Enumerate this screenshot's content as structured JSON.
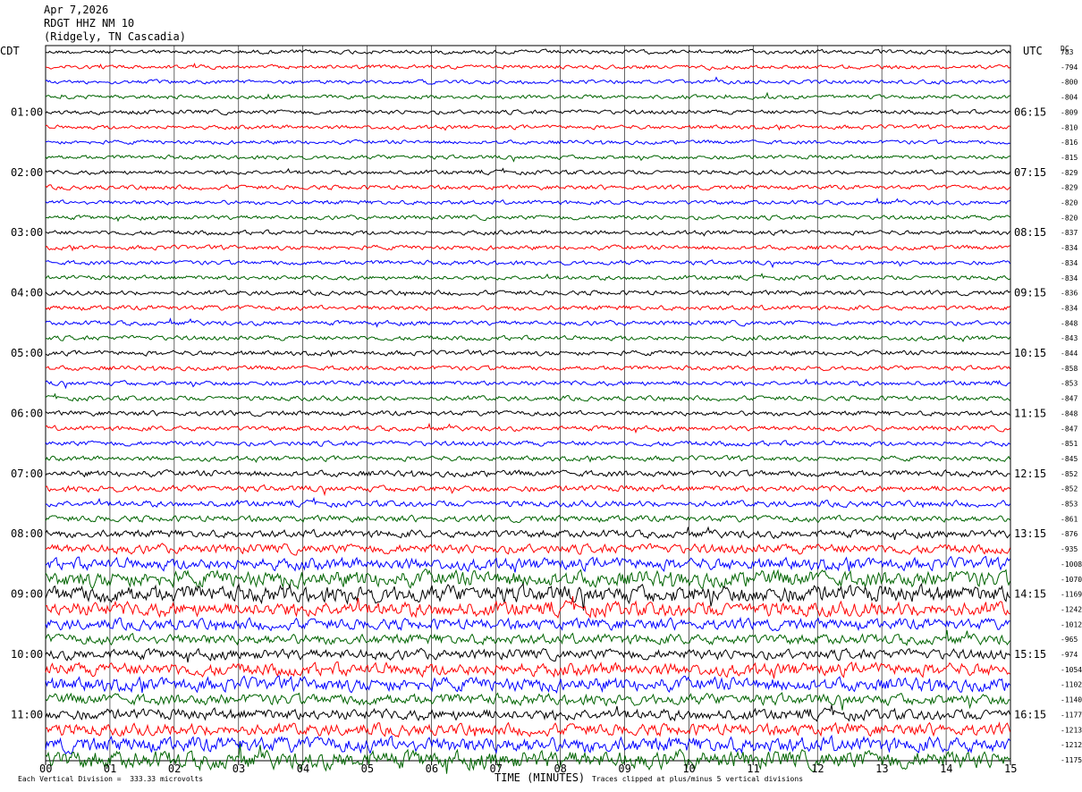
{
  "header": {
    "date": "Apr 7,2026",
    "station": "RDGT HHZ NM 10",
    "location": "(Ridgely, TN Cascadia)"
  },
  "left_tz": "CDT",
  "right_tz": "UTC",
  "dc_label": "DC",
  "footer": {
    "scale_note": "Each Vertical Division =  333.33 microvolts",
    "xlabel": "TIME (MINUTES)",
    "clip_note": "Traces clipped at plus/minus 5 vertical divisions"
  },
  "colors": {
    "trace_cycle": [
      "#000000",
      "#ff0000",
      "#0000ff",
      "#006400"
    ],
    "grid": "#000000"
  },
  "chart_data": {
    "type": "line",
    "title": "RDGT HHZ NM 10",
    "xlabel": "TIME (MINUTES)",
    "ylabel": "",
    "xlim": [
      0,
      15
    ],
    "x_ticks": [
      "00",
      "01",
      "02",
      "03",
      "04",
      "05",
      "06",
      "07",
      "08",
      "09",
      "10",
      "11",
      "12",
      "13",
      "14",
      "15"
    ],
    "left_hour_labels": [
      "01:00",
      "02:00",
      "03:00",
      "04:00",
      "05:00",
      "06:00",
      "07:00",
      "08:00",
      "09:00",
      "10:00",
      "11:00"
    ],
    "right_hour_labels": [
      "06:15",
      "07:15",
      "08:15",
      "09:15",
      "10:15",
      "11:15",
      "12:15",
      "13:15",
      "14:15",
      "15:15",
      "16:15"
    ],
    "dc_offsets": [
      "783",
      "-794",
      "-800",
      "-804",
      "-809",
      "-810",
      "-816",
      "-815",
      "-829",
      "-829",
      "-820",
      "-820",
      "-837",
      "-834",
      "-834",
      "-834",
      "-836",
      "-834",
      "-848",
      "-843",
      "-844",
      "-858",
      "-853",
      "-847",
      "-848",
      "-847",
      "-851",
      "-845",
      "-852",
      "-852",
      "-853",
      "-861",
      "-876",
      "-935",
      "-1008",
      "-1070",
      "-1169",
      "-1242",
      "-1012",
      "-965",
      "-974",
      "-1054",
      "-1102",
      "-1140",
      "-1177",
      "-1213",
      "-1212",
      "-1175"
    ],
    "trace_noise_level": [
      2.4,
      2.3,
      2.3,
      2.3,
      2.5,
      2.4,
      2.3,
      2.4,
      2.5,
      2.6,
      2.5,
      2.5,
      2.6,
      2.6,
      2.6,
      2.6,
      2.7,
      2.8,
      2.7,
      2.7,
      2.8,
      2.7,
      2.8,
      2.8,
      2.9,
      2.9,
      2.9,
      2.9,
      3.6,
      3.6,
      3.6,
      3.7,
      4.5,
      5.5,
      7.0,
      9.5,
      10.0,
      8.5,
      6.5,
      6.0,
      6.0,
      7.5,
      8.0,
      6.5,
      6.5,
      7.0,
      9.0,
      10.5
    ],
    "grid": true,
    "trace_interval_minutes": 15,
    "trace_count": 48
  }
}
